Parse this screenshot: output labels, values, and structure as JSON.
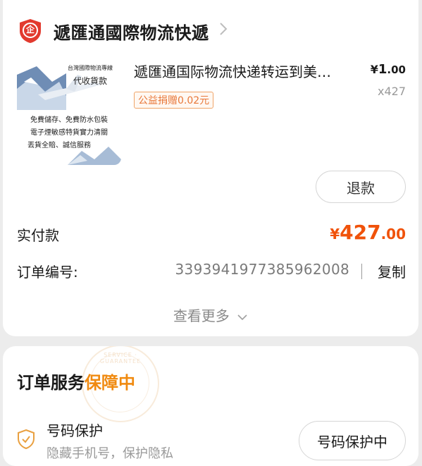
{
  "shop": {
    "name": "遞匯通國際物流快遞",
    "badge_char": "企"
  },
  "product": {
    "title": "遞匯通国际物流快递转运到美…",
    "charity_tag": "公益捐赠0.02元",
    "price_currency": "¥",
    "price_int": "1",
    "price_dec": ".00",
    "quantity": "x427",
    "thumb_lines": [
      "台灣國際物流專線",
      "代收貨款",
      "免費儲存、免費防水包裝",
      "電子煙敏感特貨實力清關",
      "丟貨全賠、誠信服務"
    ]
  },
  "actions": {
    "refund_label": "退款",
    "copy_label": "复制",
    "view_more_label": "查看更多"
  },
  "payment": {
    "label": "实付款",
    "currency": "¥",
    "amount_int": "427",
    "amount_dec": ".00"
  },
  "order": {
    "number_label": "订单编号:",
    "number": "3393941977385962008"
  },
  "service": {
    "title_prefix": "订单服务",
    "title_highlight": "保障中",
    "stamp_text": "SERVICE · GUARANTEE",
    "protection_title": "号码保护",
    "protection_desc": "隐藏手机号，保护隐私",
    "protection_button": "号码保护中"
  },
  "colors": {
    "accent_orange": "#f0520a",
    "highlight_orange": "#f08a10",
    "badge_red": "#e23a2e"
  },
  "icons": {
    "badge": "enterprise-badge-icon",
    "chevron_right": "chevron-right-icon",
    "chevron_down": "chevron-down-icon",
    "shield": "shield-check-icon"
  }
}
